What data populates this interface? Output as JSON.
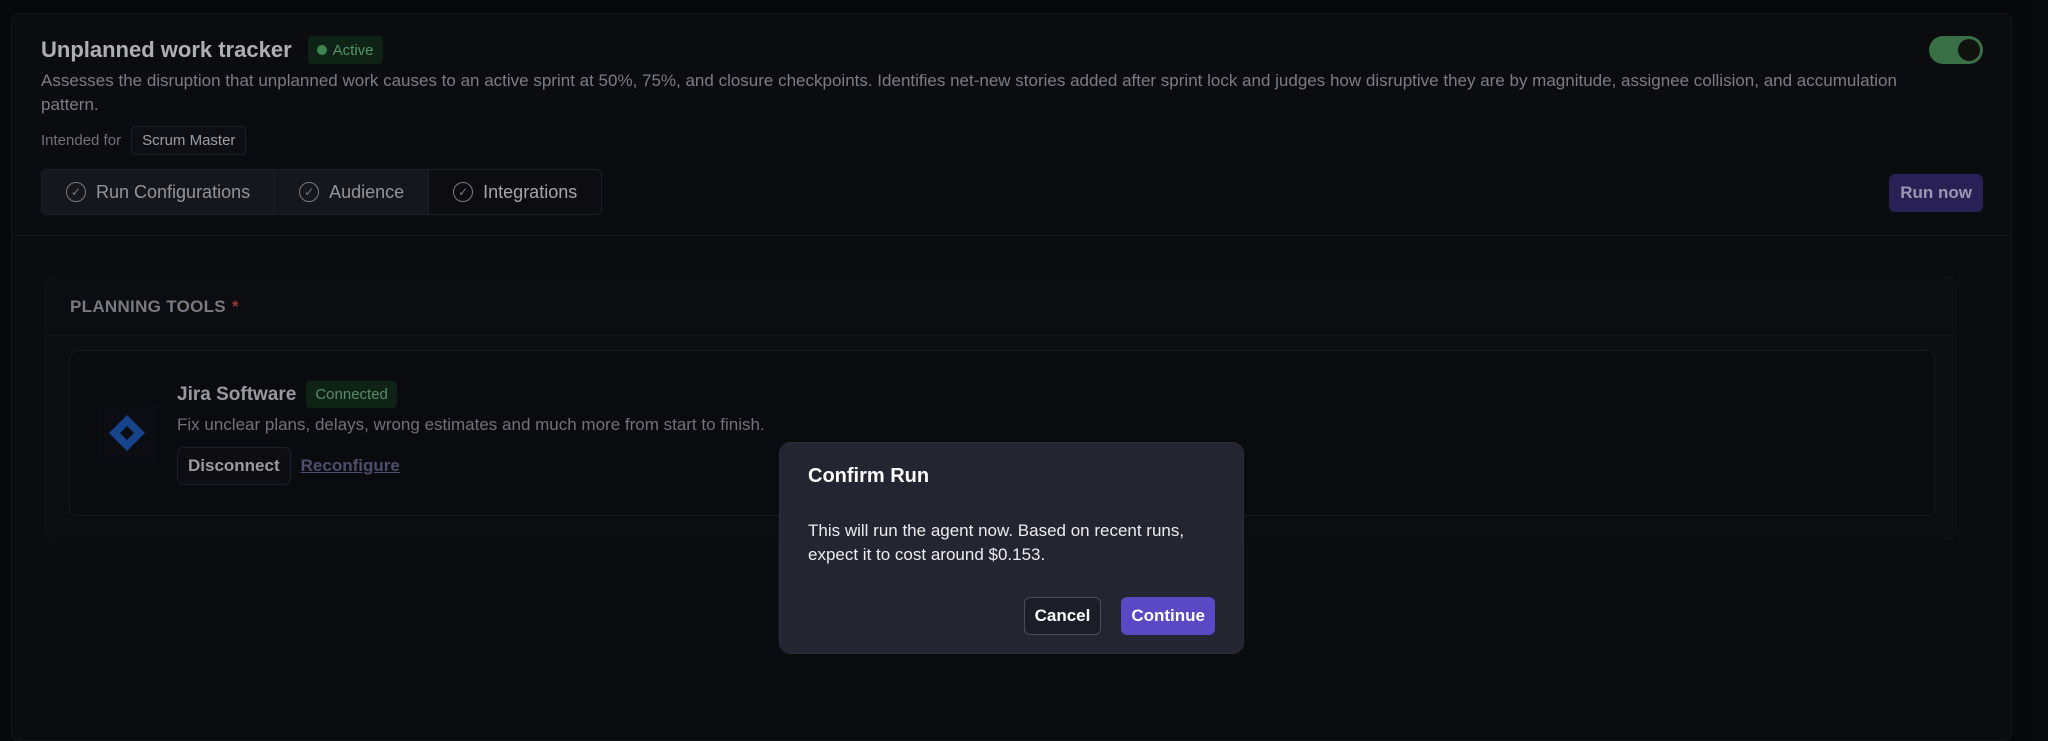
{
  "header": {
    "title": "Unplanned work tracker",
    "status": "Active",
    "description": "Assesses the disruption that unplanned work causes to an active sprint at 50%, 75%, and closure checkpoints. Identifies net-new stories added after sprint lock and judges how disruptive they are by magnitude, assignee collision, and accumulation pattern.",
    "intended_label": "Intended for",
    "intended_role": "Scrum Master",
    "run_now_label": "Run now",
    "toggle_on": true
  },
  "tabs": [
    {
      "label": "Run Configurations",
      "icon": "check-circle-icon"
    },
    {
      "label": "Audience",
      "icon": "check-circle-icon"
    },
    {
      "label": "Integrations",
      "icon": "check-circle-icon"
    }
  ],
  "planning_tools": {
    "heading": "PLANNING TOOLS",
    "required_marker": "*",
    "integration": {
      "name": "Jira Software",
      "status": "Connected",
      "description": "Fix unclear plans, delays, wrong estimates and much more from start to finish.",
      "disconnect_label": "Disconnect",
      "reconfigure_label": "Reconfigure",
      "icon": "jira-logo"
    }
  },
  "modal": {
    "title": "Confirm Run",
    "body": "This will run the agent now. Based on recent runs, expect it to cost around $0.153.",
    "cancel_label": "Cancel",
    "continue_label": "Continue"
  },
  "colors": {
    "accent": "#5a48c4",
    "success": "#56b870",
    "background": "#0b0c0f"
  }
}
